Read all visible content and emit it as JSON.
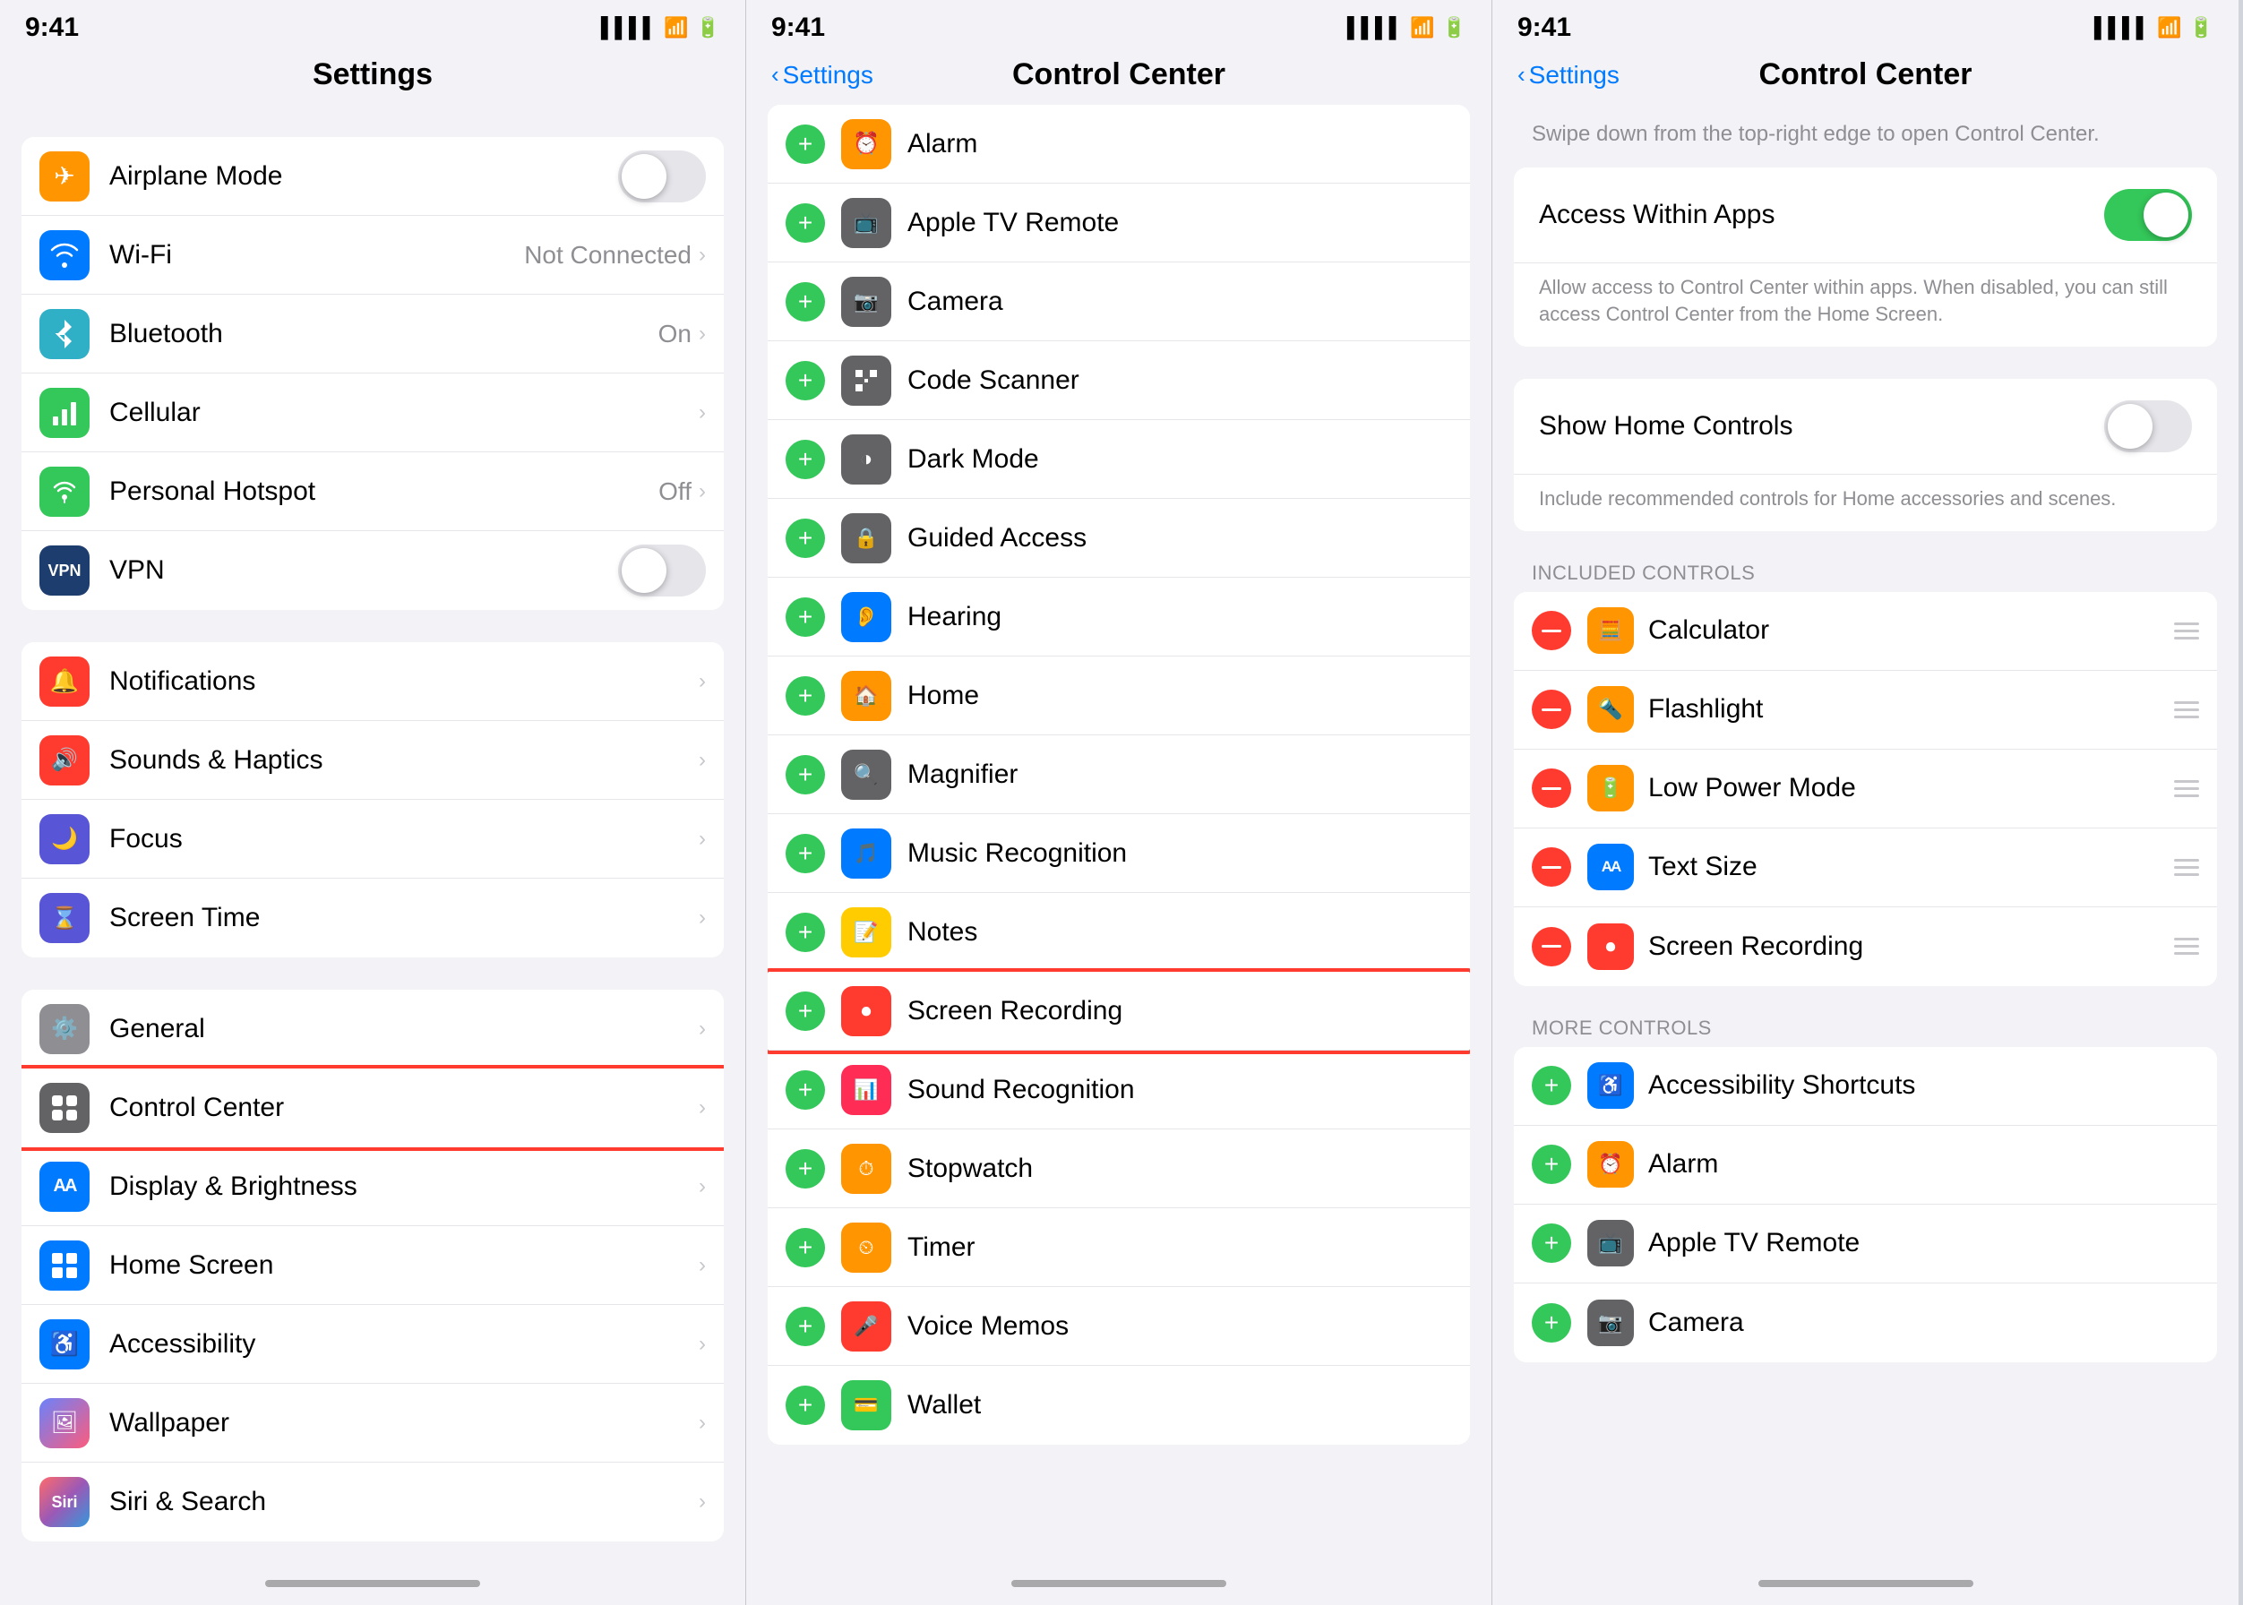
{
  "panel1": {
    "status": {
      "time": "9:41"
    },
    "title": "Settings",
    "sections": [
      {
        "items": [
          {
            "id": "airplane",
            "icon_bg": "bg-orange",
            "icon": "✈",
            "label": "Airplane Mode",
            "value_type": "toggle",
            "toggle_on": false
          },
          {
            "id": "wifi",
            "icon_bg": "bg-blue",
            "icon": "📶",
            "label": "Wi-Fi",
            "value": "Not Connected",
            "value_type": "nav"
          },
          {
            "id": "bluetooth",
            "icon_bg": "bg-blue2",
            "icon": "🔵",
            "label": "Bluetooth",
            "value": "On",
            "value_type": "nav"
          },
          {
            "id": "cellular",
            "icon_bg": "bg-green",
            "icon": "📡",
            "label": "Cellular",
            "value_type": "nav"
          },
          {
            "id": "hotspot",
            "icon_bg": "bg-green",
            "icon": "📶",
            "label": "Personal Hotspot",
            "value": "Off",
            "value_type": "nav"
          },
          {
            "id": "vpn",
            "icon_bg": "bg-vpn",
            "icon": "VPN",
            "label": "VPN",
            "value_type": "toggle",
            "toggle_on": false
          }
        ]
      },
      {
        "items": [
          {
            "id": "notifications",
            "icon_bg": "bg-red",
            "icon": "🔔",
            "label": "Notifications",
            "value_type": "nav"
          },
          {
            "id": "sounds",
            "icon_bg": "bg-red",
            "icon": "🔊",
            "label": "Sounds & Haptics",
            "value_type": "nav"
          },
          {
            "id": "focus",
            "icon_bg": "bg-indigo",
            "icon": "🌙",
            "label": "Focus",
            "value_type": "nav"
          },
          {
            "id": "screentime",
            "icon_bg": "bg-purple",
            "icon": "⌛",
            "label": "Screen Time",
            "value_type": "nav"
          }
        ]
      },
      {
        "items": [
          {
            "id": "general",
            "icon_bg": "bg-gray",
            "icon": "⚙",
            "label": "General",
            "value_type": "nav"
          },
          {
            "id": "controlcenter",
            "icon_bg": "bg-control",
            "icon": "⊞",
            "label": "Control Center",
            "value_type": "nav",
            "highlighted": true
          },
          {
            "id": "display",
            "icon_bg": "bg-blue",
            "icon": "AA",
            "label": "Display & Brightness",
            "value_type": "nav"
          },
          {
            "id": "homescreen",
            "icon_bg": "bg-blue",
            "icon": "⊞",
            "label": "Home Screen",
            "value_type": "nav"
          },
          {
            "id": "accessibility",
            "icon_bg": "bg-blue",
            "icon": "♿",
            "label": "Accessibility",
            "value_type": "nav"
          },
          {
            "id": "wallpaper",
            "icon_bg": "bg-wallpaper",
            "icon": "🖼",
            "label": "Wallpaper",
            "value_type": "nav"
          },
          {
            "id": "siri",
            "icon_bg": "bg-siri",
            "icon": "◎",
            "label": "Siri & Search",
            "value_type": "nav"
          }
        ]
      }
    ]
  },
  "panel2": {
    "status": {
      "time": "9:41"
    },
    "back_label": "Settings",
    "title": "Control Center",
    "items": [
      {
        "id": "alarm",
        "icon_bg": "bg-orange",
        "icon": "⏰",
        "label": "Alarm"
      },
      {
        "id": "appletv",
        "icon_bg": "bg-darkgray",
        "icon": "📺",
        "label": "Apple TV Remote"
      },
      {
        "id": "camera",
        "icon_bg": "bg-darkgray",
        "icon": "📷",
        "label": "Camera"
      },
      {
        "id": "codescanner",
        "icon_bg": "bg-darkgray",
        "icon": "⬛",
        "label": "Code Scanner"
      },
      {
        "id": "darkmode",
        "icon_bg": "bg-darkgray",
        "icon": "◑",
        "label": "Dark Mode"
      },
      {
        "id": "guidedaccess",
        "icon_bg": "bg-darkgray",
        "icon": "🔒",
        "label": "Guided Access"
      },
      {
        "id": "hearing",
        "icon_bg": "bg-blue",
        "icon": "👂",
        "label": "Hearing"
      },
      {
        "id": "home",
        "icon_bg": "bg-orange",
        "icon": "🏠",
        "label": "Home"
      },
      {
        "id": "magnifier",
        "icon_bg": "bg-darkgray",
        "icon": "🔍",
        "label": "Magnifier"
      },
      {
        "id": "musicrecog",
        "icon_bg": "bg-blue",
        "icon": "🎵",
        "label": "Music Recognition"
      },
      {
        "id": "notes",
        "icon_bg": "bg-yellow",
        "icon": "📝",
        "label": "Notes"
      },
      {
        "id": "screenrecording",
        "icon_bg": "bg-red",
        "icon": "⏺",
        "label": "Screen Recording",
        "highlighted": true
      },
      {
        "id": "soundrecog",
        "icon_bg": "bg-pink",
        "icon": "📊",
        "label": "Sound Recognition"
      },
      {
        "id": "stopwatch",
        "icon_bg": "bg-orange",
        "icon": "⏱",
        "label": "Stopwatch"
      },
      {
        "id": "timer",
        "icon_bg": "bg-orange",
        "icon": "⏲",
        "label": "Timer"
      },
      {
        "id": "voicememos",
        "icon_bg": "bg-red",
        "icon": "🎤",
        "label": "Voice Memos"
      },
      {
        "id": "wallet",
        "icon_bg": "bg-green",
        "icon": "💳",
        "label": "Wallet"
      }
    ]
  },
  "panel3": {
    "status": {
      "time": "9:41"
    },
    "back_label": "Settings",
    "title": "Control Center",
    "description": "Swipe down from the top-right edge to open Control Center.",
    "access_within_apps_label": "Access Within Apps",
    "access_within_apps_on": true,
    "access_within_apps_desc": "Allow access to Control Center within apps. When disabled, you can still access Control Center from the Home Screen.",
    "show_home_controls_label": "Show Home Controls",
    "show_home_controls_on": false,
    "show_home_controls_desc": "Include recommended controls for Home accessories and scenes.",
    "included_controls_header": "INCLUDED CONTROLS",
    "more_controls_header": "MORE CONTROLS",
    "included_controls": [
      {
        "id": "calc",
        "icon_bg": "bg-orange",
        "icon": "🧮",
        "label": "Calculator"
      },
      {
        "id": "flashlight",
        "icon_bg": "bg-orange",
        "icon": "🔦",
        "label": "Flashlight"
      },
      {
        "id": "lowpower",
        "icon_bg": "bg-orange",
        "icon": "🔋",
        "label": "Low Power Mode"
      },
      {
        "id": "textsize",
        "icon_bg": "bg-blue",
        "icon": "AA",
        "label": "Text Size"
      },
      {
        "id": "screenrec",
        "icon_bg": "bg-red",
        "icon": "⏺",
        "label": "Screen Recording"
      }
    ],
    "more_controls": [
      {
        "id": "accshortcuts",
        "icon_bg": "bg-blue",
        "icon": "♿",
        "label": "Accessibility Shortcuts"
      },
      {
        "id": "alarm2",
        "icon_bg": "bg-orange",
        "icon": "⏰",
        "label": "Alarm"
      },
      {
        "id": "appletv2",
        "icon_bg": "bg-darkgray",
        "icon": "📺",
        "label": "Apple TV Remote"
      },
      {
        "id": "camera2",
        "icon_bg": "bg-darkgray",
        "icon": "📷",
        "label": "Camera"
      }
    ]
  }
}
